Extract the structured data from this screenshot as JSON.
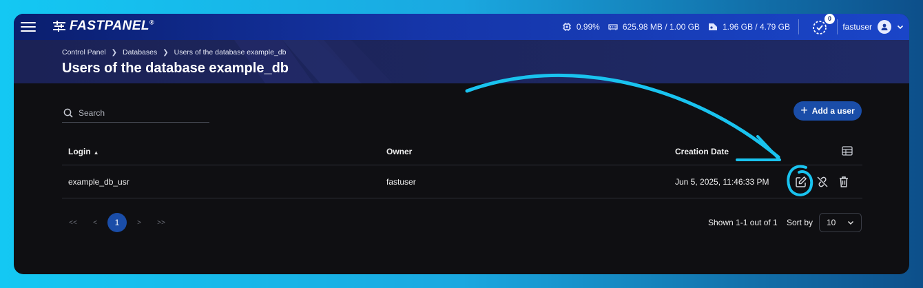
{
  "topbar": {
    "logo_text": "FASTPANEL",
    "logo_mark": "®",
    "cpu": "0.99%",
    "ram": "625.98 MB / 1.00 GB",
    "disk": "1.96 GB / 4.79 GB",
    "tasks_count": "0",
    "username": "fastuser"
  },
  "breadcrumb": [
    "Control Panel",
    "Databases",
    "Users of the database example_db"
  ],
  "page_title": "Users of the database example_db",
  "search": {
    "placeholder": "Search"
  },
  "add_button": {
    "label": "Add a user"
  },
  "table": {
    "columns": {
      "login": "Login",
      "owner": "Owner",
      "created": "Creation Date"
    },
    "rows": [
      {
        "login": "example_db_usr",
        "owner": "fastuser",
        "created": "Jun 5, 2025, 11:46:33 PM"
      }
    ]
  },
  "pagination": {
    "first": "<<",
    "prev": "<",
    "current": "1",
    "next": ">",
    "last": ">>",
    "shown": "Shown 1-1 out of 1",
    "sort_by_label": "Sort by",
    "page_size": "10"
  },
  "colors": {
    "accent": "#1a4da8",
    "annotation": "#19c3ef",
    "background": "#0f0f12"
  },
  "icons": [
    "menu-icon",
    "cpu-icon",
    "ram-icon",
    "disk-icon",
    "tasks-icon",
    "user-icon",
    "chevron-down-icon",
    "search-icon",
    "plus-icon",
    "column-settings-icon",
    "edit-icon",
    "unlink-icon",
    "trash-icon"
  ]
}
